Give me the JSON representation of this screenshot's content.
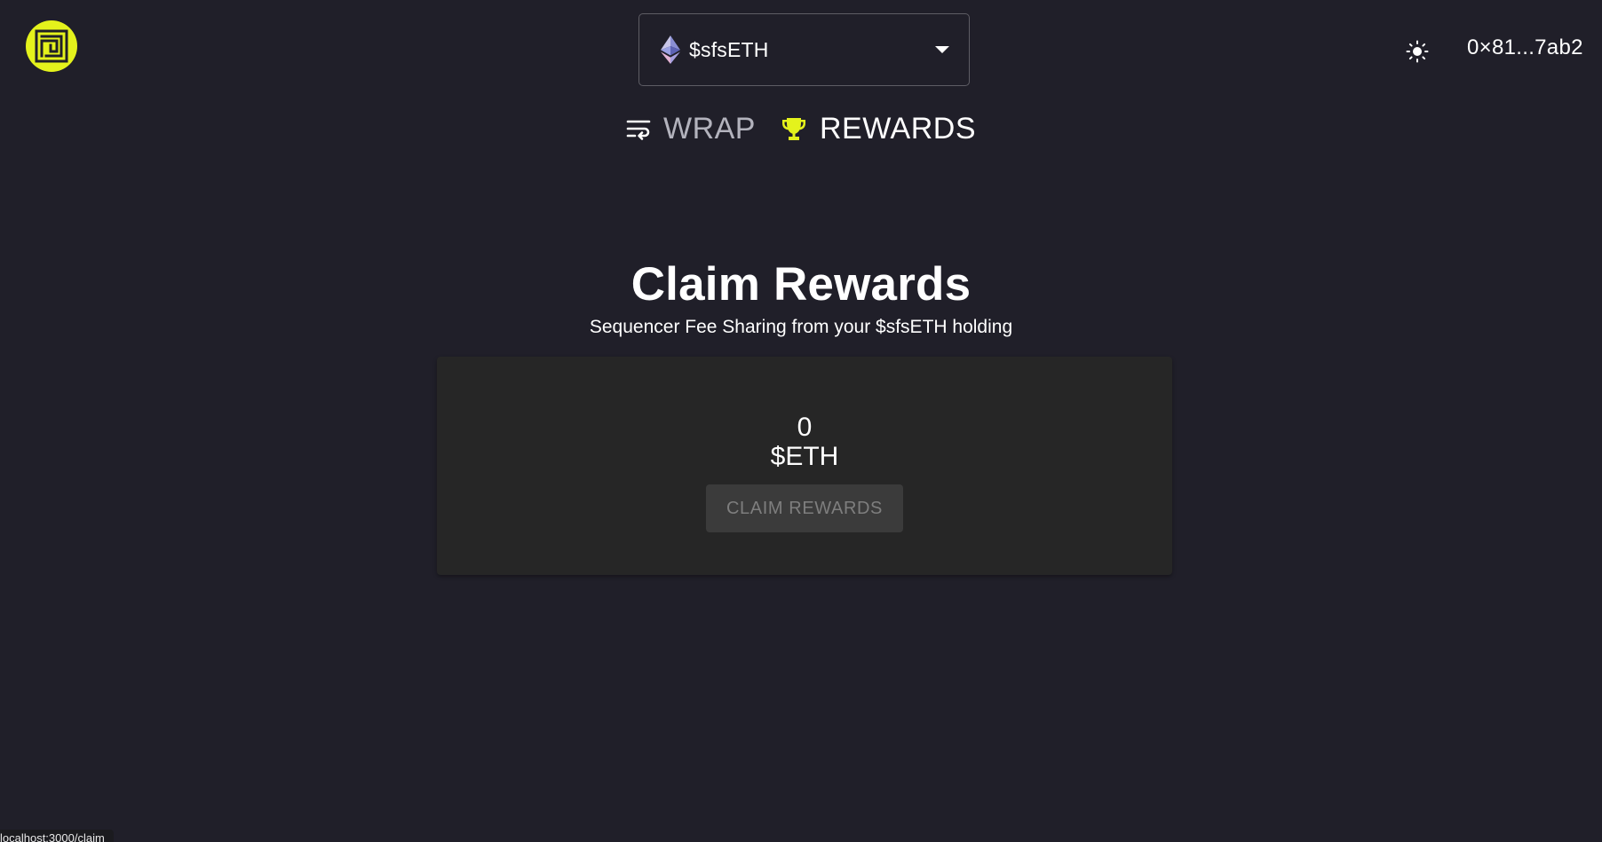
{
  "header": {
    "logo_icon": "maze-logo-icon",
    "token_selector": {
      "selected": "$sfsETH",
      "icon": "ethereum-icon"
    },
    "theme_icon": "sun-icon",
    "wallet_address": "0×81...7ab2"
  },
  "nav": {
    "tabs": [
      {
        "label": "WRAP",
        "icon": "wrap-icon",
        "active": false
      },
      {
        "label": "REWARDS",
        "icon": "trophy-icon",
        "active": true
      }
    ]
  },
  "main": {
    "title": "Claim Rewards",
    "subtitle": "Sequencer Fee Sharing from your $sfsETH holding",
    "reward": {
      "amount": "0",
      "unit": "$ETH"
    },
    "claim_button_label": "CLAIM REWARDS",
    "claim_button_disabled": true
  },
  "status_bar": {
    "url": "localhost:3000/claim"
  },
  "colors": {
    "background": "#201f29",
    "accent": "#e4f21c",
    "card": "#262626",
    "button_disabled": "#3b3b3b"
  }
}
